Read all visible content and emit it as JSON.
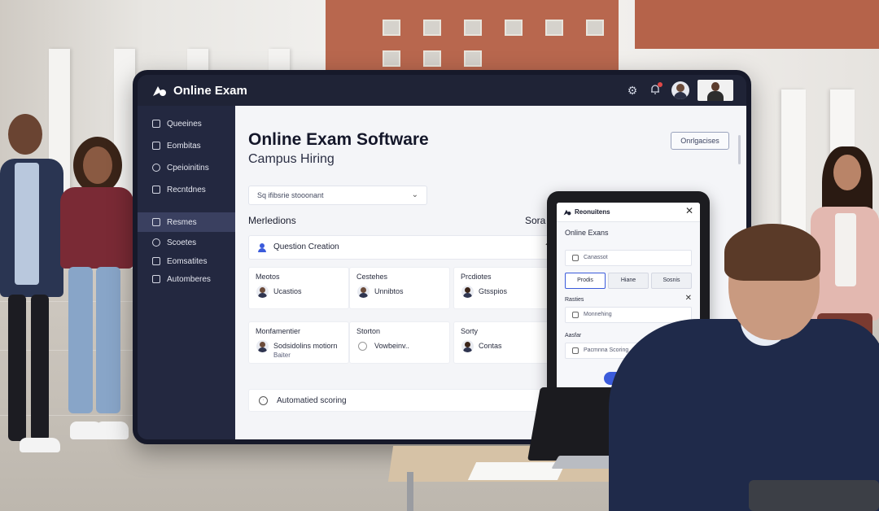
{
  "app": {
    "title": "Online Exam"
  },
  "sidebar": {
    "items": [
      {
        "label": "Queeines",
        "icon": "list-icon"
      },
      {
        "label": "Eombitas",
        "icon": "calendar-icon"
      },
      {
        "label": "Cpeioinitins",
        "icon": "user-icon"
      },
      {
        "label": "Recntdnes",
        "icon": "document-icon"
      },
      {
        "label": "Resmes",
        "icon": "folder-icon",
        "active": true
      },
      {
        "label": "Scoetes",
        "icon": "user-icon"
      },
      {
        "label": "Eomsatites",
        "icon": "mail-icon"
      },
      {
        "label": "Automberes",
        "icon": "grid-icon"
      }
    ]
  },
  "main": {
    "title": "Online Exam Software",
    "subtitle": "Campus Hiring",
    "top_button": "Onrlgacises",
    "select": {
      "value": "Sq ifibsrie stooonant"
    },
    "section_left": "Merledions",
    "section_right": "Sora",
    "question_creation": "Question Creation",
    "cards": [
      {
        "title": "Meotos",
        "name": "Ucastios",
        "extra": ""
      },
      {
        "title": "Cestehes",
        "name": "Unnibtos",
        "extra": ""
      },
      {
        "title": "Prcdiotes",
        "name": "Gtsspios",
        "extra": ""
      },
      {
        "title": "Monfamentier",
        "name": "Sodsidolins motiorn",
        "extra": "Baiter"
      },
      {
        "title": "Storton",
        "name": "Vowbeinv..",
        "extra": ""
      },
      {
        "title": "Sorty",
        "name": "Contas",
        "extra": ""
      }
    ],
    "automated_scoring": "Automatied scoring"
  },
  "phone": {
    "header_title": "Reonuitens",
    "page_title": "Online Exans",
    "field_1": "Canassot",
    "tabs": [
      "Prodis",
      "Hiane",
      "Sosnis"
    ],
    "label_1": "Rasties",
    "field_2": "Monnehing",
    "label_2": "Aasfar",
    "field_3": "Pacmnna Scoring",
    "button": "Prodis"
  },
  "colors": {
    "dark_bg": "#1f2336",
    "sidebar_bg": "#232840",
    "accent_blue": "#3b5bdb",
    "content_bg": "#f4f5f8"
  }
}
